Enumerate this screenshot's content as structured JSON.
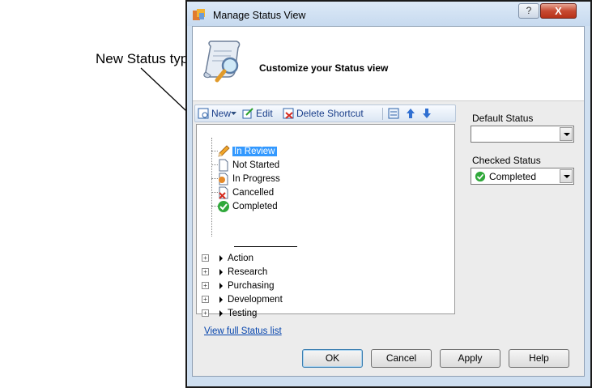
{
  "callout": {
    "text": "New Status type"
  },
  "window": {
    "title": "Manage Status View",
    "help_glyph": "?",
    "close_glyph": "X"
  },
  "header": {
    "title": "Customize your Status view"
  },
  "toolbar": {
    "new_label": "New",
    "edit_label": "Edit",
    "delete_shortcut_label": "Delete Shortcut"
  },
  "tree": {
    "statuses": [
      {
        "label": "In Review",
        "icon": "pencil-icon",
        "selected": true
      },
      {
        "label": "Not Started",
        "icon": "blank-page-icon"
      },
      {
        "label": "In Progress",
        "icon": "in-progress-icon"
      },
      {
        "label": "Cancelled",
        "icon": "cancelled-icon"
      },
      {
        "label": "Completed",
        "icon": "green-check-icon"
      }
    ],
    "groups": [
      {
        "label": "Action"
      },
      {
        "label": "Research"
      },
      {
        "label": "Purchasing"
      },
      {
        "label": "Development"
      },
      {
        "label": "Testing"
      }
    ]
  },
  "links": {
    "view_full": "View full Status list"
  },
  "side": {
    "default_status_label": "Default Status",
    "default_status_value": "",
    "checked_status_label": "Checked Status",
    "checked_status_value": "Completed"
  },
  "buttons": {
    "ok": "OK",
    "cancel": "Cancel",
    "apply": "Apply",
    "help": "Help"
  },
  "colors": {
    "selection": "#3399ff",
    "link": "#0645ad",
    "check_green": "#2fa83a",
    "close_red": "#c74a32"
  }
}
